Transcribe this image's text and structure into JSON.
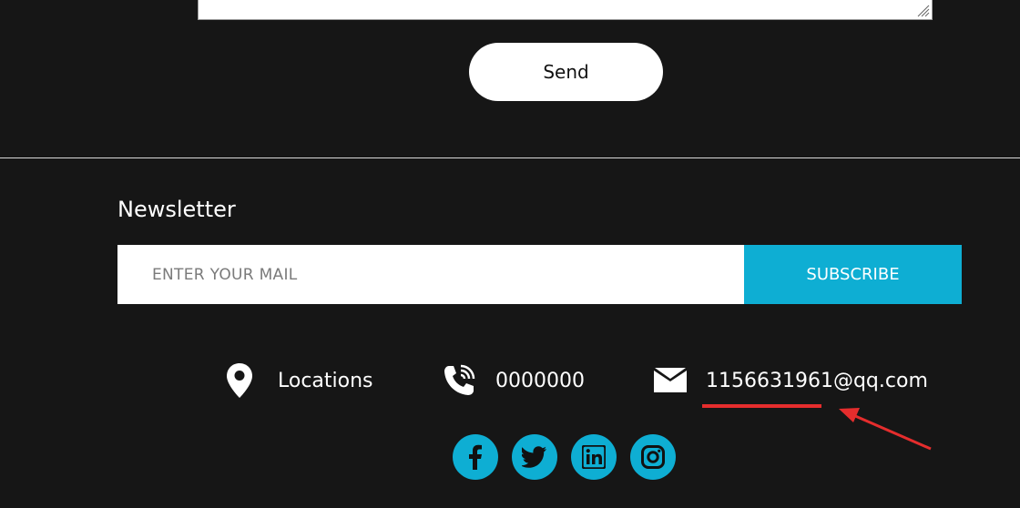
{
  "contact_form": {
    "send_label": "Send"
  },
  "newsletter": {
    "title": "Newsletter",
    "email_placeholder": "ENTER YOUR MAIL",
    "subscribe_label": "SUBSCRIBE"
  },
  "contact_info": {
    "location": {
      "icon": "map-pin-icon",
      "text": "Locations"
    },
    "phone": {
      "icon": "phone-icon",
      "text": "0000000"
    },
    "email": {
      "icon": "envelope-icon",
      "text": "1156631961@qq.com"
    }
  },
  "social": [
    {
      "name": "facebook",
      "icon": "facebook-icon"
    },
    {
      "name": "twitter",
      "icon": "twitter-icon"
    },
    {
      "name": "linkedin",
      "icon": "linkedin-icon"
    },
    {
      "name": "instagram",
      "icon": "instagram-icon"
    }
  ],
  "colors": {
    "background": "#161616",
    "accent": "#0eaed3",
    "annotation": "#e52d2d"
  }
}
